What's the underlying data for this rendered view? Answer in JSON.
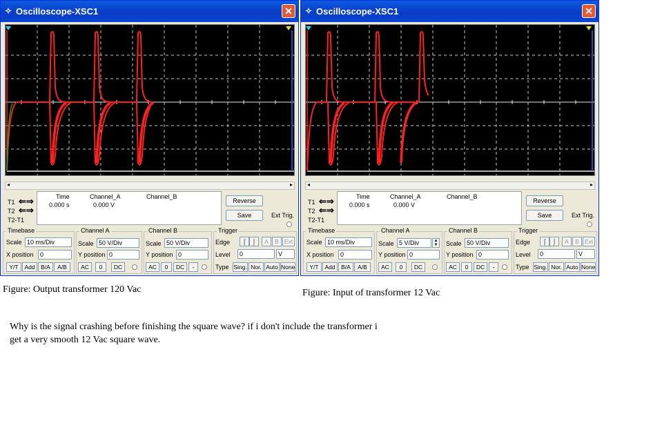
{
  "colors": {
    "title_bar": "#0a45d2",
    "screen_bg": "#000000",
    "trace_a": "#ff2020",
    "trace_green": "#20a020",
    "grid": "#c8c8c8"
  },
  "windows": [
    {
      "title": "Oscilloscope-XSC1",
      "cursors": {
        "t1": "T1",
        "t2": "T2",
        "t2t1": "T2-T1",
        "arrows": "⇐⇒"
      },
      "readout": {
        "time_header": "Time",
        "cha_header": "Channel_A",
        "chb_header": "Channel_B",
        "time_value": "0.000 s",
        "cha_value": "0.000 V"
      },
      "buttons": {
        "reverse": "Reverse",
        "save": "Save",
        "ext_trig": "Ext Trig."
      },
      "timebase": {
        "title": "Timebase",
        "scale_label": "Scale",
        "scale_value": "10 ms/Div",
        "xpos_label": "X position",
        "xpos_value": "0",
        "yt": "Y/T",
        "add": "Add",
        "ba": "B/A",
        "ab": "A/B"
      },
      "channel_a": {
        "title": "Channel A",
        "scale_label": "Scale",
        "scale_value": "50  V/Div",
        "ypos_label": "Y position",
        "ypos_value": "0",
        "ac": "AC",
        "zero": "0",
        "dc": "DC"
      },
      "channel_b": {
        "title": "Channel B",
        "scale_label": "Scale",
        "scale_value": "50  V/Div",
        "ypos_label": "Y position",
        "ypos_value": "0",
        "ac": "AC",
        "zero": "0",
        "dc": "DC",
        "minus": "-"
      },
      "trigger": {
        "title": "Trigger",
        "edge_label": "Edge",
        "a": "A",
        "b": "B",
        "ext": "Ext",
        "level_label": "Level",
        "level_value": "0",
        "level_unit": "V",
        "type_label": "Type",
        "sing": "Sing.",
        "nor": "Nor.",
        "auto": "Auto",
        "none": "None"
      }
    },
    {
      "title": "Oscilloscope-XSC1",
      "cursors": {
        "t1": "T1",
        "t2": "T2",
        "t2t1": "T2-T1",
        "arrows": "⇐⇒"
      },
      "readout": {
        "time_header": "Time",
        "cha_header": "Channel_A",
        "chb_header": "Channel_B",
        "time_value": "0.000 s",
        "cha_value": "0.000 V"
      },
      "buttons": {
        "reverse": "Reverse",
        "save": "Save",
        "ext_trig": "Ext Trig."
      },
      "timebase": {
        "title": "Timebase",
        "scale_label": "Scale",
        "scale_value": "10 ms/Div",
        "xpos_label": "X position",
        "xpos_value": "0",
        "yt": "Y/T",
        "add": "Add",
        "ba": "B/A",
        "ab": "A/B"
      },
      "channel_a": {
        "title": "Channel A",
        "scale_label": "Scale",
        "scale_value": "5  V/Div",
        "ypos_label": "Y position",
        "ypos_value": "0",
        "ac": "AC",
        "zero": "0",
        "dc": "DC"
      },
      "channel_b": {
        "title": "Channel B",
        "scale_label": "Scale",
        "scale_value": "50  V/Div",
        "ypos_label": "Y position",
        "ypos_value": "0",
        "ac": "AC",
        "zero": "0",
        "dc": "DC",
        "minus": "-"
      },
      "trigger": {
        "title": "Trigger",
        "edge_label": "Edge",
        "a": "A",
        "b": "B",
        "ext": "Ext",
        "level_label": "Level",
        "level_value": "0",
        "level_unit": "V",
        "type_label": "Type",
        "sing": "Sing.",
        "nor": "Nor.",
        "auto": "Auto",
        "none": "None"
      }
    }
  ],
  "captions": [
    "Figure:  Output transformer 120 Vac",
    "Figure:  Input of transformer 12 Vac"
  ],
  "question": {
    "line1": "Why is the signal crashing before finishing the square wave?  if i don't include the transformer i",
    "line2": "get a very smooth 12 Vac square wave."
  }
}
